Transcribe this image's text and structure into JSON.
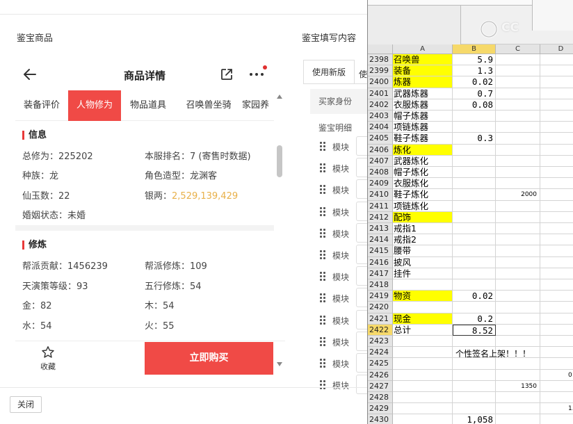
{
  "dialog": {
    "left_title": "鉴宝商品",
    "right_title": "鉴宝填写内容",
    "close_label": "关闭"
  },
  "phone": {
    "title": "商品详情",
    "tabs": [
      {
        "label": "装备评价",
        "active": false
      },
      {
        "label": "人物修为",
        "active": true
      },
      {
        "label": "物品道具",
        "active": false
      },
      {
        "label": "召唤兽坐骑",
        "active": false
      },
      {
        "label": "家园养",
        "active": false
      }
    ],
    "section_info": {
      "title": "信息",
      "items": [
        {
          "k": "总修为：",
          "v": "225202"
        },
        {
          "k": "本服排名：",
          "v": "7 (寄售时数据)"
        },
        {
          "k": "种族：",
          "v": "龙"
        },
        {
          "k": "角色造型：",
          "v": "龙渊客"
        },
        {
          "k": "仙玉数：",
          "v": "22"
        },
        {
          "k": "银两：",
          "v": "2,529,139,429"
        },
        {
          "k": "婚姻状态：",
          "v": "未婚"
        }
      ]
    },
    "section_train": {
      "title": "修炼",
      "items": [
        {
          "k": "帮派贡献：",
          "v": "1456239"
        },
        {
          "k": "帮派修炼：",
          "v": "109"
        },
        {
          "k": "天演策等级：",
          "v": "93"
        },
        {
          "k": "五行修炼：",
          "v": "54"
        },
        {
          "k": "金：",
          "v": "82"
        },
        {
          "k": "木：",
          "v": "54"
        },
        {
          "k": "水：",
          "v": "54"
        },
        {
          "k": "火：",
          "v": "55"
        }
      ]
    },
    "fav_label": "收藏",
    "buy_label": "立即购买",
    "colors": {
      "accent": "#f04a46",
      "silver_value": "#e8b048"
    }
  },
  "right_panel": {
    "tab_active": "使用新版",
    "tab_other": "使",
    "sub1": "买家身份",
    "sub2": "鉴宝明细",
    "module_label": "模块",
    "module_count_visible": 12
  },
  "excel": {
    "watermark": "CC",
    "columns": [
      "A",
      "B",
      "C",
      "D"
    ],
    "selected_column": "B",
    "rows": [
      {
        "n": "2398",
        "a": "召唤兽",
        "a_yellow": true,
        "b": "5.9"
      },
      {
        "n": "2399",
        "a": "装备",
        "a_yellow": true,
        "b": "1.3"
      },
      {
        "n": "2400",
        "a": "炼器",
        "a_yellow": true,
        "b": "0.02"
      },
      {
        "n": "2401",
        "a": "武器炼器",
        "b": "0.7"
      },
      {
        "n": "2402",
        "a": "衣服炼器",
        "b": "0.08"
      },
      {
        "n": "2403",
        "a": "帽子炼器"
      },
      {
        "n": "2404",
        "a": "项链炼器"
      },
      {
        "n": "2405",
        "a": "鞋子炼器",
        "b": "0.3"
      },
      {
        "n": "2406",
        "a": "炼化",
        "a_yellow": true
      },
      {
        "n": "2407",
        "a": "武器炼化"
      },
      {
        "n": "2408",
        "a": "帽子炼化"
      },
      {
        "n": "2409",
        "a": "衣服炼化"
      },
      {
        "n": "2410",
        "a": "鞋子炼化",
        "c": "2000"
      },
      {
        "n": "2411",
        "a": "项链炼化"
      },
      {
        "n": "2412",
        "a": "配饰",
        "a_yellow": true
      },
      {
        "n": "2413",
        "a": "戒指1"
      },
      {
        "n": "2414",
        "a": "戒指2"
      },
      {
        "n": "2415",
        "a": "腰带"
      },
      {
        "n": "2416",
        "a": "披风"
      },
      {
        "n": "2417",
        "a": "挂件"
      },
      {
        "n": "2418"
      },
      {
        "n": "2419",
        "a": "物资",
        "a_yellow": true,
        "b": "0.02"
      },
      {
        "n": "2420"
      },
      {
        "n": "2421",
        "a": "现金",
        "a_yellow": true,
        "b": "0.2"
      },
      {
        "n": "2422",
        "a": "总计",
        "b": "8.52",
        "selected": true
      },
      {
        "n": "2423"
      },
      {
        "n": "2424",
        "banner": "个性签名上架！！！"
      },
      {
        "n": "2425"
      },
      {
        "n": "2426",
        "d": "0"
      },
      {
        "n": "2427",
        "c": "1350"
      },
      {
        "n": "2428"
      },
      {
        "n": "2429",
        "d": "1."
      },
      {
        "n": "2430",
        "b": "1,058"
      }
    ]
  }
}
